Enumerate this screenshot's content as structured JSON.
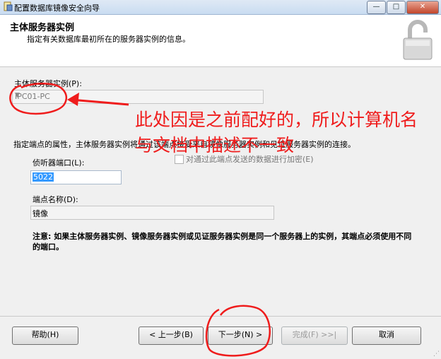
{
  "window": {
    "title": "配置数据库镜像安全向导",
    "controls": {
      "min": "—",
      "max": "□",
      "close": "✕"
    }
  },
  "header": {
    "title": "主体服务器实例",
    "subtitle": "指定有关数据库最初所在的服务器实例的信息。",
    "icon": "padlock-icon"
  },
  "form": {
    "instance_label": "主体服务器实例(P):",
    "instance_value": "IPC01-PC",
    "endpoint_props_label": "指定端点的属性，主体服务器实例将通过该端点接受来自镜像服务器实例和见证服务器实例的连接。",
    "port_label": "侦听器端口(L):",
    "port_value": "5022",
    "encrypt_label": "对通过此端点发送的数据进行加密(E)",
    "endpoint_name_label": "端点名称(D):",
    "endpoint_name_value": "镜像",
    "note": "注意: 如果主体服务器实例、镜像服务器实例或见证服务器实例是同一个服务器上的实例，其端点必须使用不同的端口。"
  },
  "buttons": {
    "help": "帮助(H)",
    "back": "< 上一步(B)",
    "next": "下一步(N) >",
    "finish": "完成(F) >>|",
    "cancel": "取消"
  },
  "annotation": {
    "text": "此处因是之前配好的，所以计算机名与文档中描述不一致",
    "color": "#ef1c1c"
  }
}
